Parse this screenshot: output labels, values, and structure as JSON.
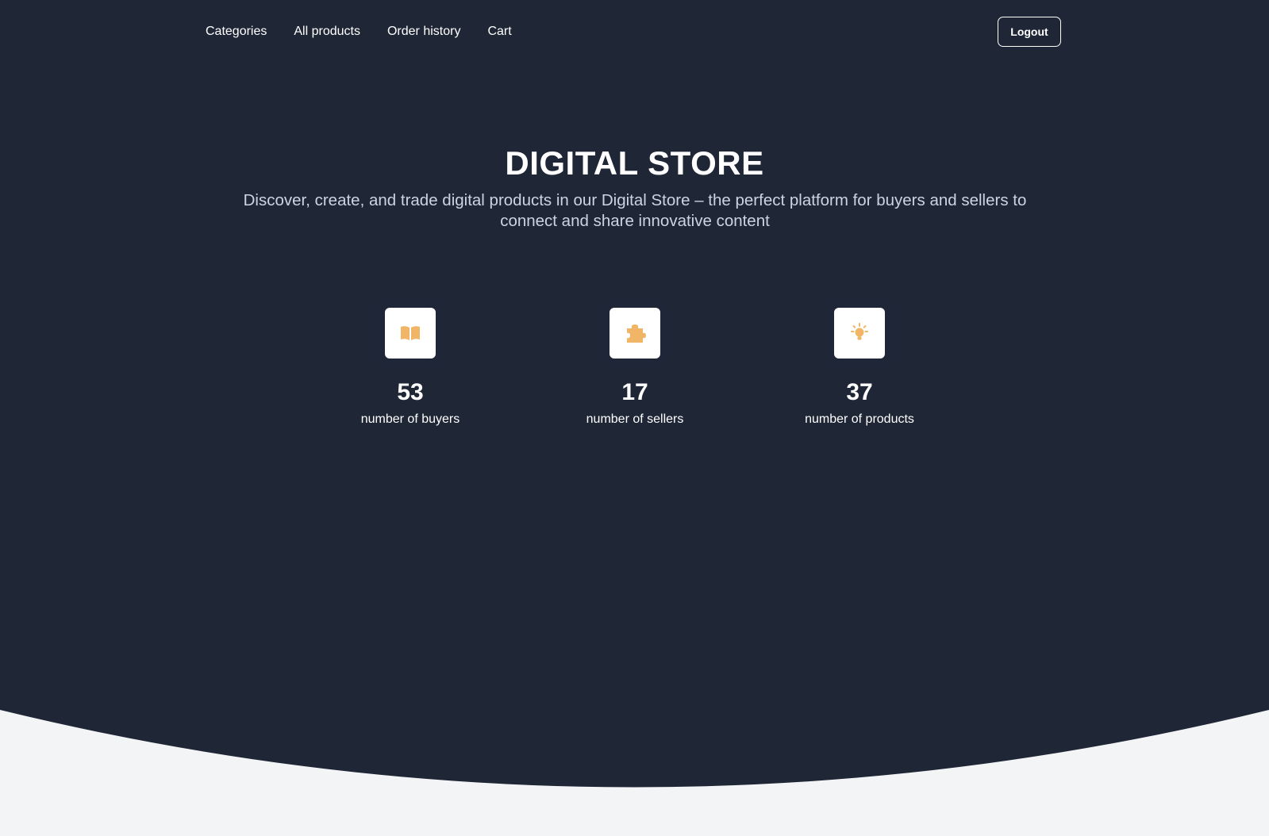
{
  "nav": {
    "links": [
      {
        "label": "Categories"
      },
      {
        "label": "All products"
      },
      {
        "label": "Order history"
      },
      {
        "label": "Cart"
      }
    ],
    "logout_label": "Logout"
  },
  "hero": {
    "title": "DIGITAL STORE",
    "subtitle": "Discover, create, and trade digital products in our Digital Store – the perfect platform for buyers and sellers to connect and share innovative content"
  },
  "stats": [
    {
      "value": "53",
      "label": "number of buyers",
      "icon": "book-icon"
    },
    {
      "value": "17",
      "label": "number of sellers",
      "icon": "puzzle-icon"
    },
    {
      "value": "37",
      "label": "number of products",
      "icon": "lightbulb-icon"
    }
  ],
  "colors": {
    "hero_bg": "#1f2636",
    "page_bg": "#f3f4f6",
    "accent": "#f0b566",
    "text": "#ffffff",
    "subtitle": "#cbd5e1"
  }
}
